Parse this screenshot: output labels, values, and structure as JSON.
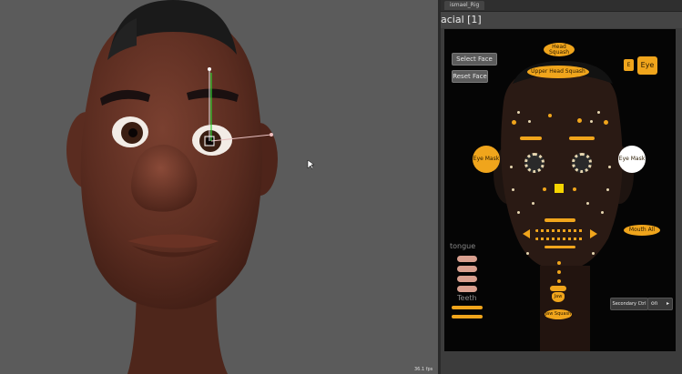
{
  "viewport": {
    "status_text": "36.1 fps"
  },
  "panel": {
    "tab_label": "ismael_Rig",
    "title": "acial [1]",
    "buttons": {
      "select_face": "Select Face",
      "reset_face": "Reset Face",
      "head_squash": "Head Squash",
      "upper_head_squash": "Upper Head Squash",
      "eye_left_small": "E",
      "eye_right": "Eye",
      "eye_mask_left": "Eye Mask",
      "eye_mask_right": "Eye Mask",
      "mouth_all": "Mouth All",
      "tongue_label": "tongue",
      "teeth_label": "Teeth",
      "secondary_ctrl": "Secondary Ctrl",
      "secondary_state": "on",
      "jaw_label": "Jaw",
      "jaw_squash": "Jaw Squash"
    }
  },
  "colors": {
    "accent_orange": "#f0a51c",
    "ctrl_yellow": "#f5d400",
    "white_ctrl": "#ffffff",
    "pink_ctrl": "#d9a08f"
  }
}
